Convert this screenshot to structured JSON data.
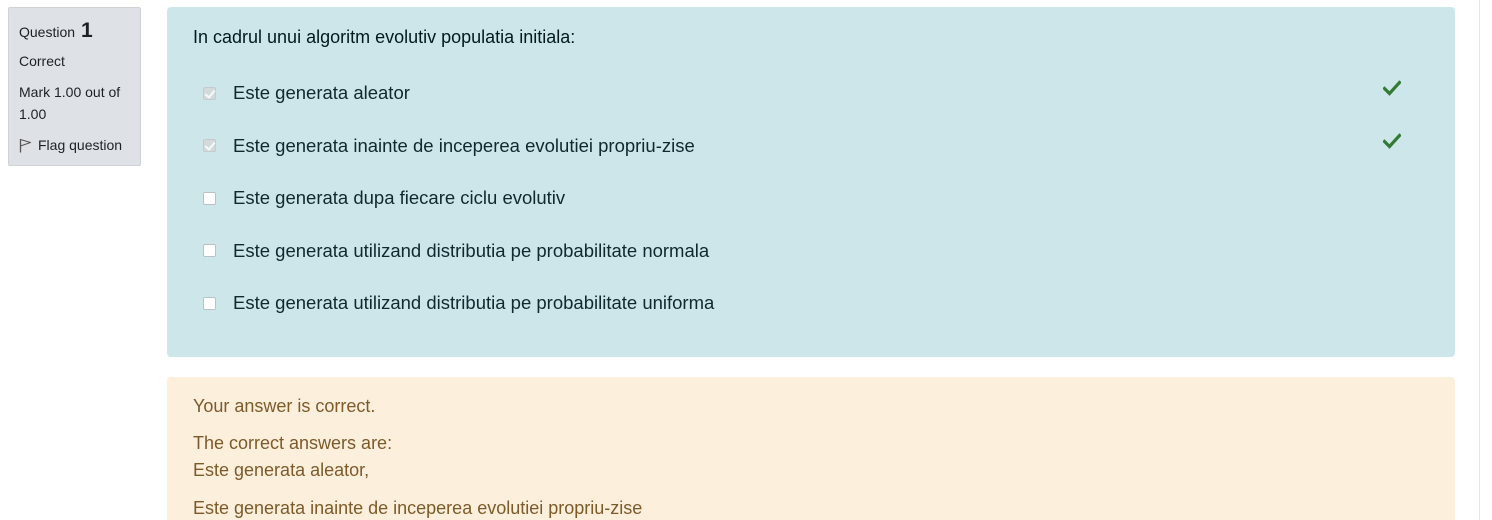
{
  "info": {
    "question_label": "Question",
    "question_number": "1",
    "state": "Correct",
    "grade": "Mark 1.00 out of 1.00",
    "flag_label": "Flag question"
  },
  "question": {
    "text": "In cadrul unui algoritm evolutiv populatia initiala:",
    "options": [
      {
        "label": "Este generata aleator",
        "checked": true,
        "correct_mark": true
      },
      {
        "label": "Este generata inainte de inceperea evolutiei propriu-zise",
        "checked": true,
        "correct_mark": true
      },
      {
        "label": "Este generata dupa fiecare ciclu evolutiv",
        "checked": false,
        "correct_mark": false
      },
      {
        "label": "Este generata utilizand distributia pe probabilitate normala",
        "checked": false,
        "correct_mark": false
      },
      {
        "label": "Este generata utilizand distributia pe probabilitate uniforma",
        "checked": false,
        "correct_mark": false
      }
    ]
  },
  "feedback": {
    "general": "Your answer is correct.",
    "right_answers_label": "The correct answers are:",
    "right_answer_1": "Este generata aleator,",
    "right_answer_2": "Este generata inainte de inceperea evolutiei propriu-zise"
  },
  "colors": {
    "formulation_bg": "#cce6ea",
    "feedback_bg": "#fcefdc",
    "info_bg": "#dee2e6",
    "tick": "#357a32"
  },
  "icons": {
    "flag": "flag-icon",
    "correct": "check-icon"
  }
}
